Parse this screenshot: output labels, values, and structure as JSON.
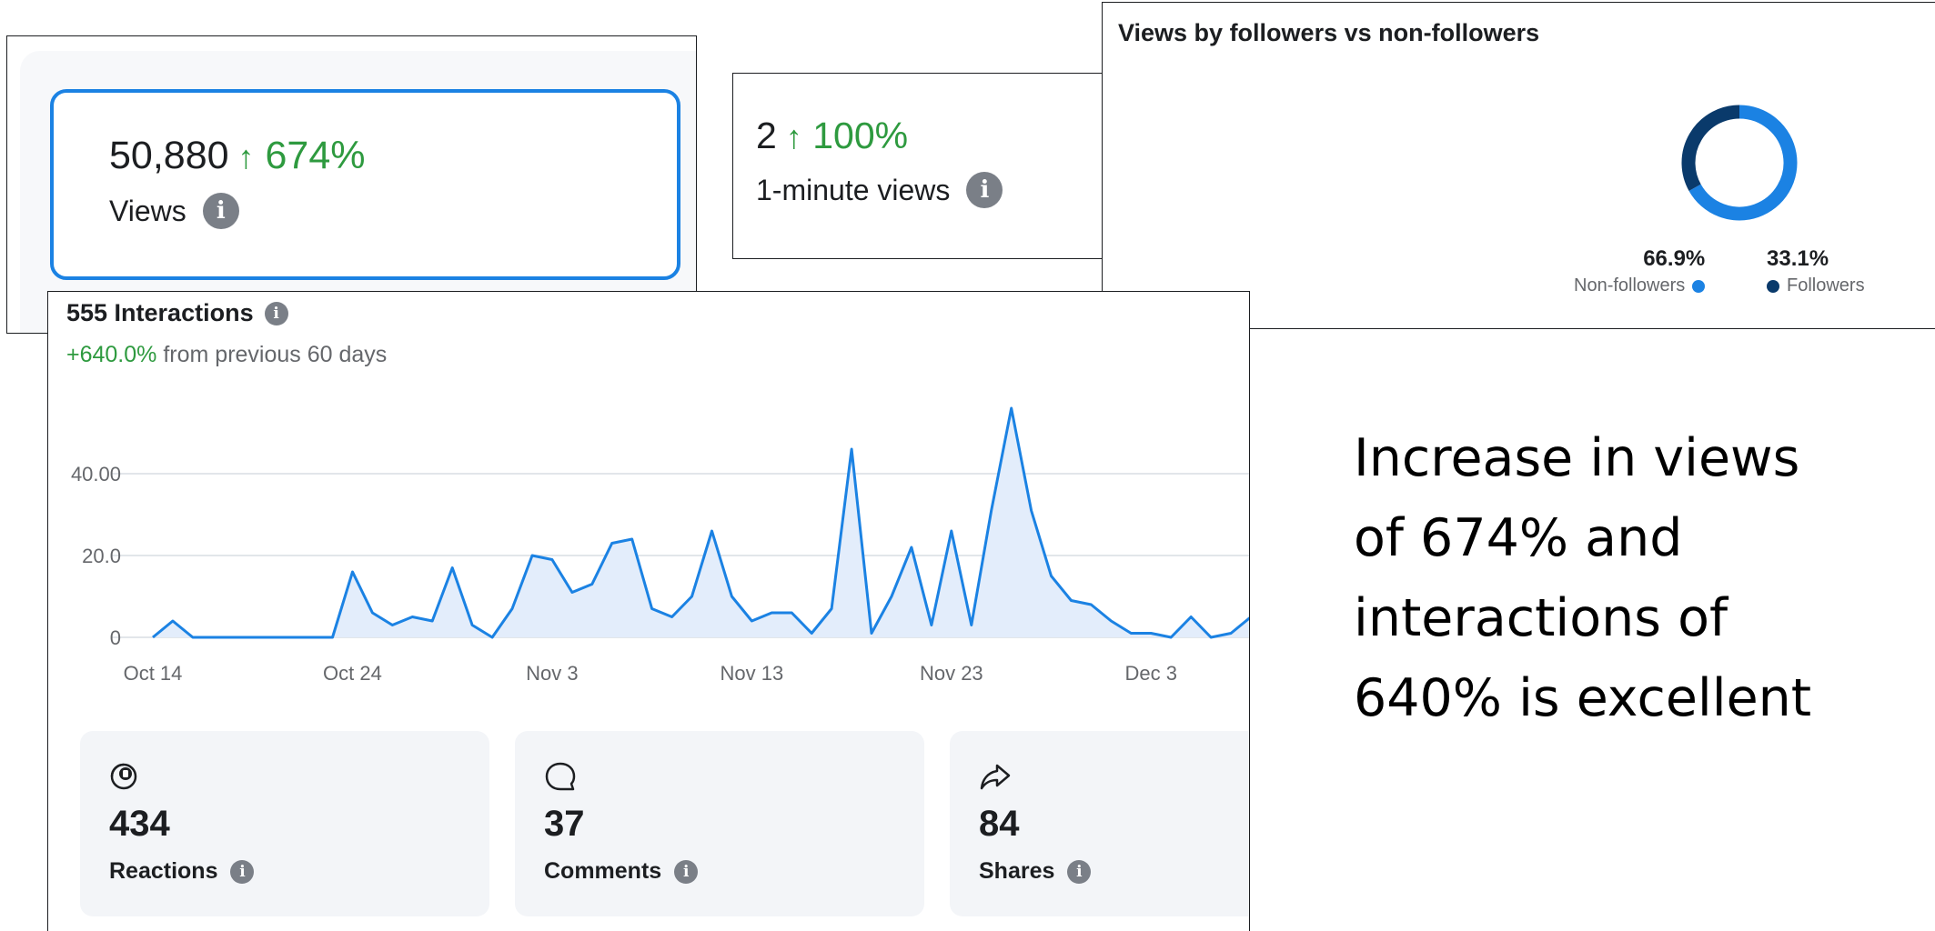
{
  "views_card": {
    "value": "50,880",
    "growth_arrow": "↑",
    "growth": "674%",
    "label": "Views",
    "accent_color": "#1b82e3",
    "growth_color": "#2e9a3f",
    "info_icon": "info-icon"
  },
  "minute_views_card": {
    "value": "2",
    "growth_arrow": "↑",
    "growth": "100%",
    "label": "1-minute views",
    "info_icon": "info-icon"
  },
  "followers_card": {
    "title": "Views by followers vs non-followers",
    "segments": [
      {
        "label": "Non-followers",
        "percent_text": "66.9%",
        "value": 66.9,
        "color": "#1b82e3"
      },
      {
        "label": "Followers",
        "percent_text": "33.1%",
        "value": 33.1,
        "color": "#0a3a6b"
      }
    ]
  },
  "interactions": {
    "title": "555 Interactions",
    "change": "+640.0%",
    "change_suffix": "from previous 60 days",
    "stats": [
      {
        "icon": "reactions-icon",
        "value": "434",
        "label": "Reactions"
      },
      {
        "icon": "comment-icon",
        "value": "37",
        "label": "Comments"
      },
      {
        "icon": "share-icon",
        "value": "84",
        "label": "Shares"
      }
    ]
  },
  "chart_data": {
    "type": "area",
    "ytick_labels": [
      "0",
      "20.0",
      "40.00"
    ],
    "yticks": [
      0,
      20,
      40
    ],
    "ylim": [
      0,
      60
    ],
    "xtick_labels": [
      "Oct 14",
      "Oct 24",
      "Nov 3",
      "Nov 13",
      "Nov 23",
      "Dec 3"
    ],
    "xticks_day_index": [
      0,
      10,
      20,
      30,
      40,
      50
    ],
    "x_start_label": "Oct 14",
    "line_color": "#1b82e3",
    "fill_color": "#e3edfb",
    "grid": true,
    "series": [
      {
        "values": [
          0,
          4,
          0,
          0,
          0,
          0,
          0,
          0,
          0,
          0,
          16,
          6,
          3,
          5,
          4,
          17,
          3,
          0,
          7,
          20,
          19,
          11,
          13,
          23,
          24,
          7,
          5,
          10,
          26,
          10,
          4,
          6,
          6,
          1,
          7,
          46,
          1,
          10,
          22,
          3,
          26,
          3,
          31,
          56,
          31,
          15,
          9,
          8,
          4,
          1,
          1,
          0,
          5,
          0,
          1,
          5
        ]
      }
    ]
  },
  "caption": {
    "lines": [
      "Increase in views",
      "of 674% and",
      "interactions of",
      "640% is excellent"
    ]
  }
}
